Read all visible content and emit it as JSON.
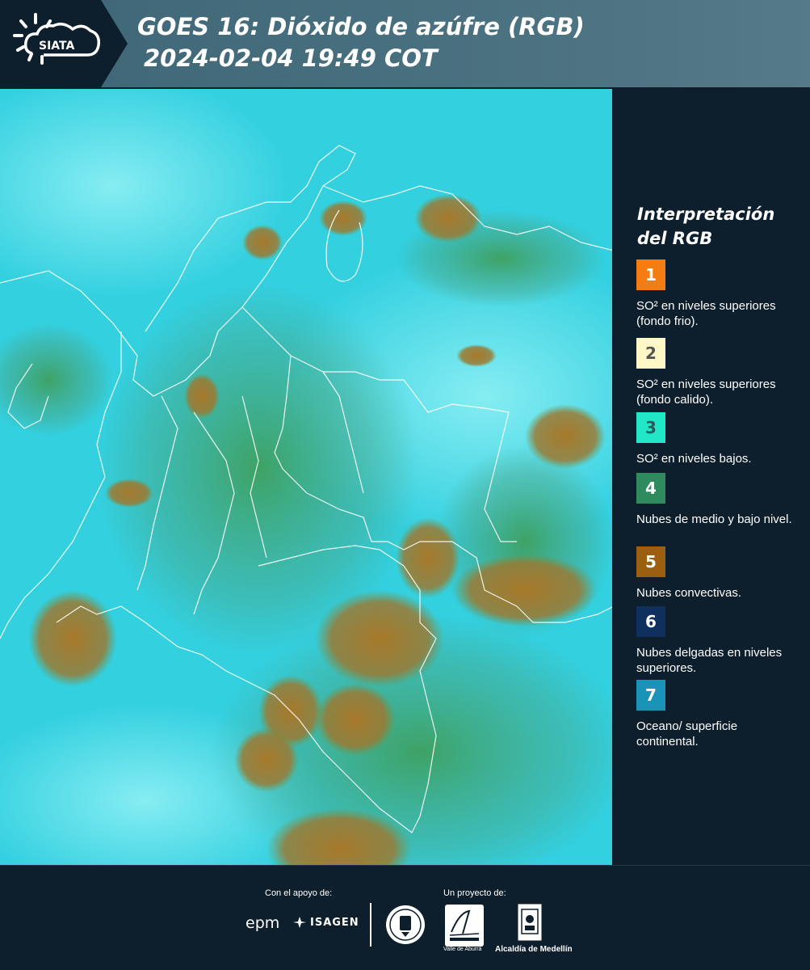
{
  "header": {
    "logo_text": "SIATA",
    "title_line1": "GOES 16: Dióxido de azúfre (RGB)",
    "title_line2": "2024-02-04 19:49 COT"
  },
  "map": {
    "description_icon": "satellite-rgb-composite",
    "colors": {
      "ocean": "#2ccfe0",
      "haze": "#6fe3ee",
      "low_cloud": "#3a9a68",
      "convective": "#a87b2c",
      "border": "#ffffff"
    }
  },
  "legend": {
    "title": "Interpretación del RGB",
    "items": [
      {
        "number": "1",
        "color": "#f57c10",
        "num_color": "#ffffff",
        "text": "SO² en niveles superiores (fondo frio)."
      },
      {
        "number": "2",
        "color": "#fff7c6",
        "num_color": "#555555",
        "text": "SO² en niveles superiores (fondo calido)."
      },
      {
        "number": "3",
        "color": "#22e6c8",
        "num_color": "#2a5a5a",
        "text": "SO² en niveles bajos."
      },
      {
        "number": "4",
        "color": "#2f8a5e",
        "num_color": "#ffffff",
        "text": "Nubes de medio y bajo nivel."
      },
      {
        "number": "5",
        "color": "#9c5f10",
        "num_color": "#ffffff",
        "text": "Nubes convectivas."
      },
      {
        "number": "6",
        "color": "#0f2f5e",
        "num_color": "#ffffff",
        "text": "Nubes delgadas en niveles superiores."
      },
      {
        "number": "7",
        "color": "#1a93b8",
        "num_color": "#ffffff",
        "text": "Oceano/ superficie continental."
      }
    ]
  },
  "footer": {
    "support_label": "Con el apoyo de:",
    "project_label": "Un proyecto de:",
    "epm": "epm",
    "isagen": "ISAGEN",
    "area_sub": "Valle de Aburrá",
    "medellin": "Alcaldía de Medellín"
  }
}
